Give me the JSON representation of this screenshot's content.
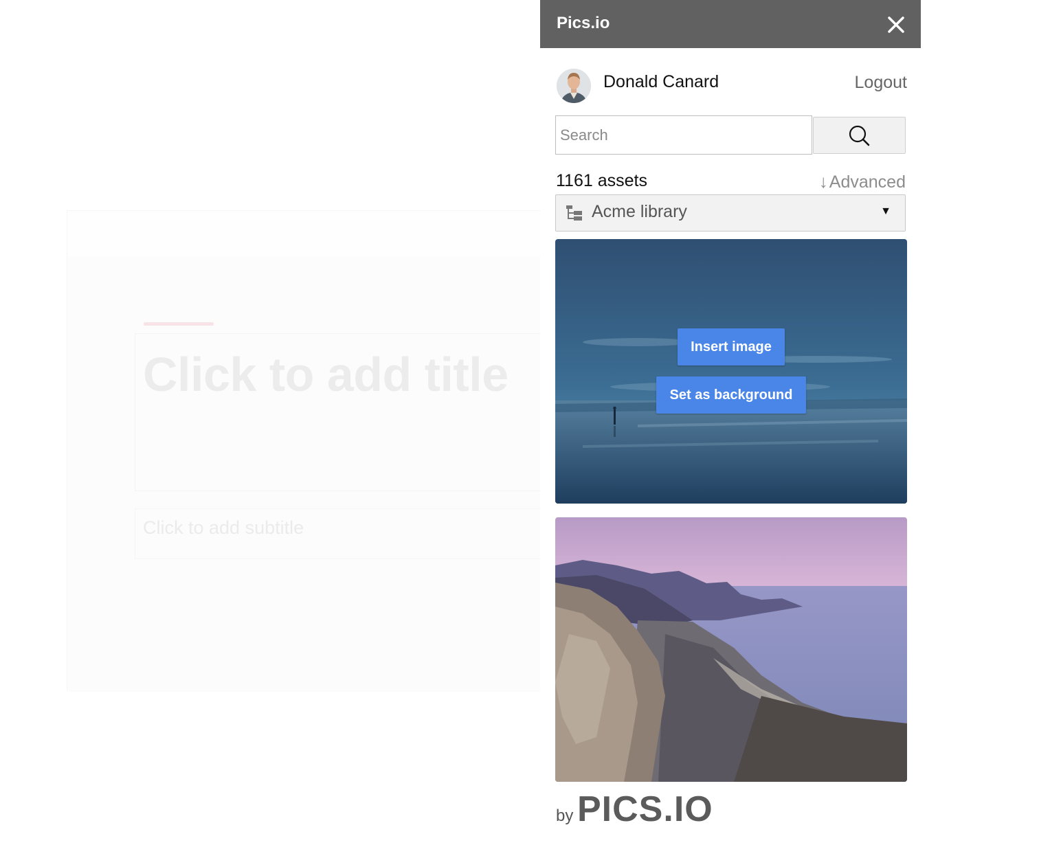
{
  "slide": {
    "title_placeholder": "Click to add title",
    "subtitle_placeholder": "Click to add subtitle"
  },
  "panel": {
    "title": "Pics.io",
    "close_icon": "close-icon",
    "user": {
      "name": "Donald Canard",
      "logout_label": "Logout"
    },
    "search": {
      "placeholder": "Search",
      "value": "",
      "button_icon": "search-icon"
    },
    "assets_count": "1161 assets",
    "advanced": {
      "arrow": "↓",
      "label": "Advanced"
    },
    "library": {
      "icon": "tree-icon",
      "selected": "Acme library",
      "caret": "▼"
    },
    "thumbnails": [
      {
        "subject": "person standing on reflective beach at dusk",
        "actions": {
          "insert_label": "Insert image",
          "background_label": "Set as background"
        }
      },
      {
        "subject": "coastal cliffs and bay at sunset"
      }
    ],
    "footer": {
      "by": "by",
      "brand": "PICS.IO"
    }
  },
  "colors": {
    "header_bg": "#616161",
    "button_blue": "#4a86e8"
  }
}
